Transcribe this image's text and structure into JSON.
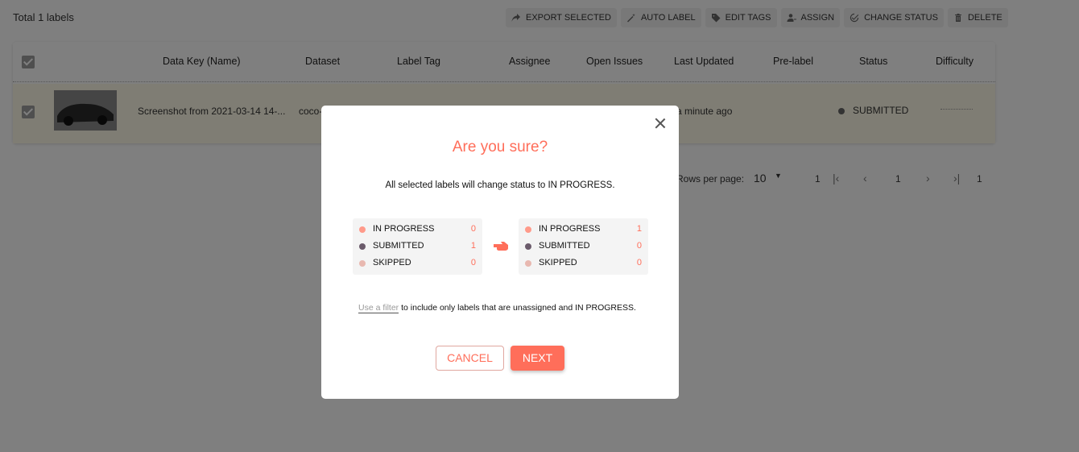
{
  "header": {
    "total_label": "Total 1 labels"
  },
  "toolbar": {
    "export_selected": "EXPORT SELECTED",
    "auto_label": "AUTO LABEL",
    "edit_tags": "EDIT TAGS",
    "assign": "ASSIGN",
    "change_status": "CHANGE STATUS",
    "delete": "DELETE"
  },
  "table": {
    "columns": {
      "data_key": "Data Key (Name)",
      "dataset": "Dataset",
      "label_tag": "Label Tag",
      "assignee": "Assignee",
      "open_issues": "Open Issues",
      "last_updated": "Last Updated",
      "pre_label": "Pre-label",
      "status": "Status",
      "difficulty": "Difficulty"
    },
    "rows": [
      {
        "name": "Screenshot from 2021-03-14 14-...",
        "dataset": "coco-",
        "last_updated": "a minute ago",
        "status": "SUBMITTED"
      }
    ]
  },
  "pagination": {
    "rows_per_page_label": "Rows per page:",
    "rows_per_page_value": "10",
    "range_start": "1",
    "current_page": "1",
    "total_pages": "1"
  },
  "modal": {
    "title": "Are you sure?",
    "subtitle": "All selected labels will change status to IN PROGRESS.",
    "before": [
      {
        "label": "IN PROGRESS",
        "value": "0"
      },
      {
        "label": "SUBMITTED",
        "value": "1"
      },
      {
        "label": "SKIPPED",
        "value": "0"
      }
    ],
    "after": [
      {
        "label": "IN PROGRESS",
        "value": "1"
      },
      {
        "label": "SUBMITTED",
        "value": "0"
      },
      {
        "label": "SKIPPED",
        "value": "0"
      }
    ],
    "footnote_link": "Use a filter",
    "footnote_text": " to include only labels that are unassigned and IN PROGRESS.",
    "cancel_label": "CANCEL",
    "next_label": "NEXT"
  },
  "colors": {
    "accent": "#ff6e5a",
    "in_progress_dot": "#ff9a8a",
    "submitted_dot": "#6b5b6b",
    "skipped_dot": "#e8b8b0"
  }
}
